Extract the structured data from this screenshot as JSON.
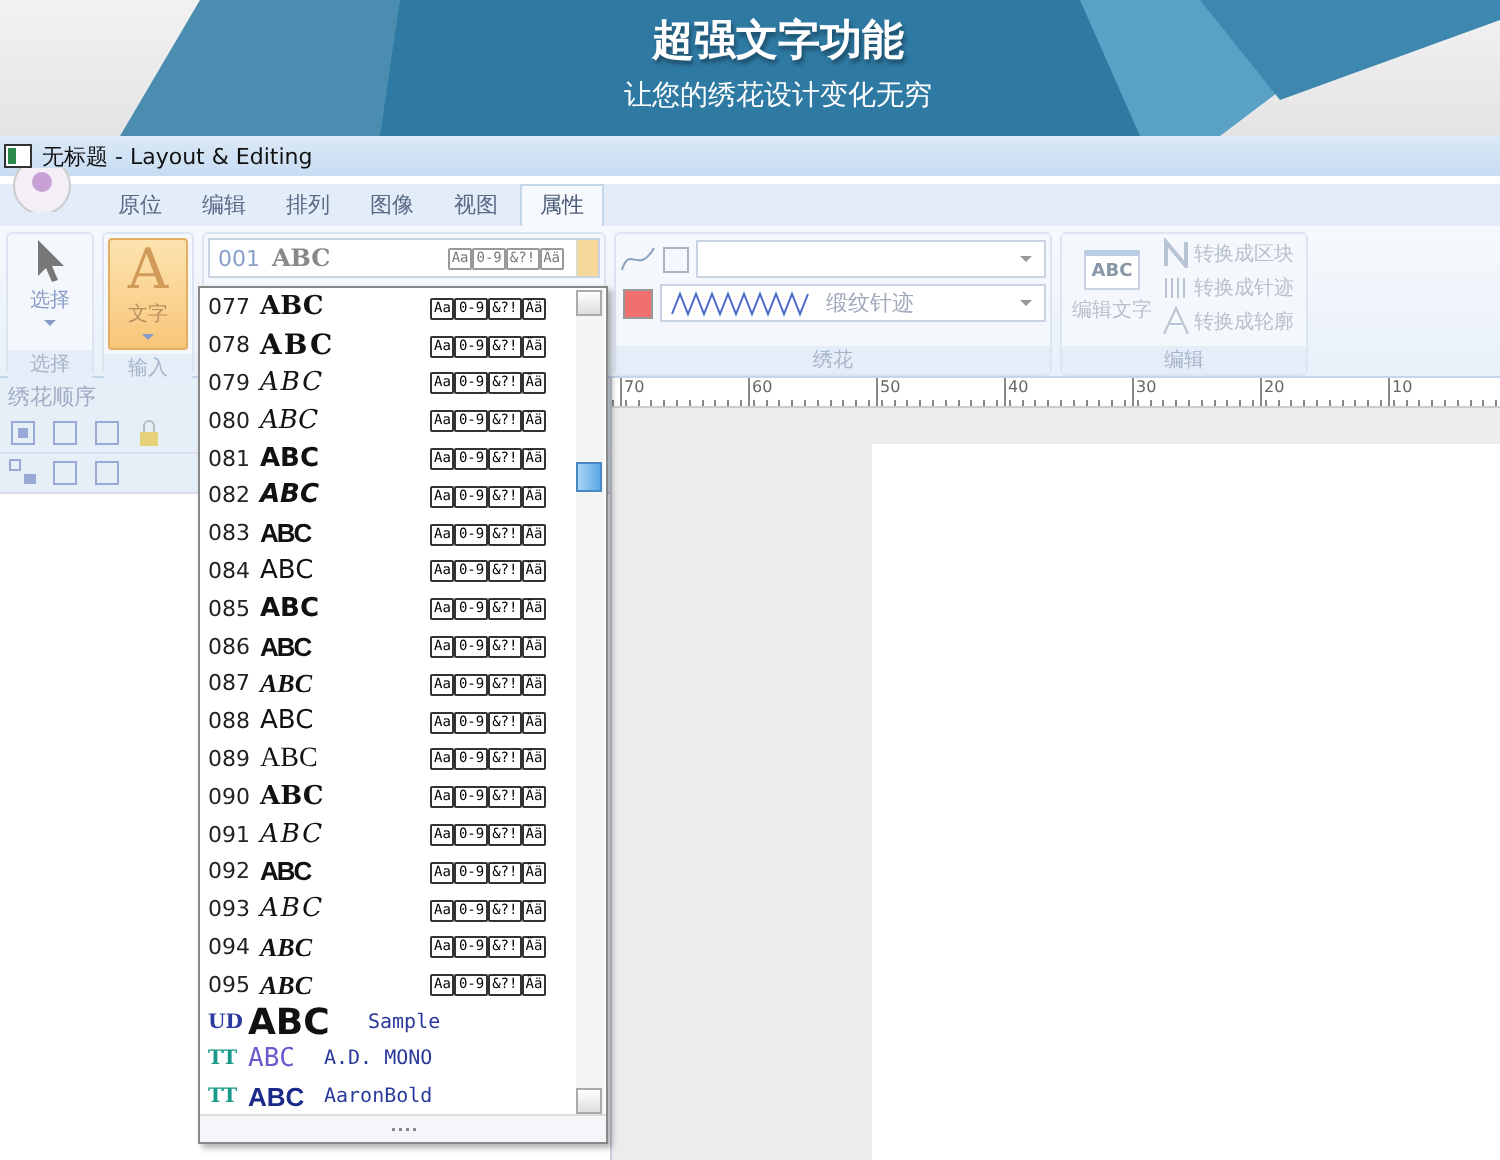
{
  "banner": {
    "headline": "超强文字功能",
    "tagline": "让您的绣花设计变化无穷"
  },
  "window": {
    "title": "无标题 - Layout & Editing"
  },
  "tabs": [
    {
      "label": "原位",
      "selected": false
    },
    {
      "label": "编辑",
      "selected": false
    },
    {
      "label": "排列",
      "selected": false
    },
    {
      "label": "图像",
      "selected": false
    },
    {
      "label": "视图",
      "selected": false
    },
    {
      "label": "属性",
      "selected": true
    }
  ],
  "ribbon": {
    "select_group": {
      "button": "选择",
      "label": "选择",
      "selected": false
    },
    "input_group": {
      "button": "文字",
      "icon_char": "A",
      "label": "输入",
      "selected": true
    },
    "font_combo": {
      "number": "001",
      "sample": "ABC",
      "charsets": [
        "Aa",
        "0-9",
        "&?!",
        "Ää"
      ]
    },
    "embroidery_group": {
      "label": "绣花",
      "stitch": "缎纹针迹"
    },
    "edit_group": {
      "label": "编辑",
      "button": "编辑文字",
      "icon_text": "ABC",
      "disabled": true,
      "actions": [
        {
          "kind": "block",
          "label": "转换成区块"
        },
        {
          "kind": "stitch",
          "label": "转换成针迹"
        },
        {
          "kind": "outline",
          "label": "转换成轮廓"
        }
      ]
    }
  },
  "left_pane": {
    "title": "绣花顺序"
  },
  "ruler": {
    "labels": [
      "70",
      "60",
      "50",
      "40",
      "30",
      "20",
      "10"
    ]
  },
  "font_list": [
    {
      "kind": "embroidery",
      "number": "077",
      "sample": "ABC",
      "charsets": [
        "Aa",
        "0-9",
        "&?!",
        "Ää"
      ]
    },
    {
      "kind": "embroidery",
      "number": "078",
      "sample": "ABC",
      "charsets": [
        "Aa",
        "0-9",
        "&?!",
        "Ää"
      ]
    },
    {
      "kind": "embroidery",
      "number": "079",
      "sample": "ABC",
      "charsets": [
        "Aa",
        "0-9",
        "&?!",
        "Ää"
      ]
    },
    {
      "kind": "embroidery",
      "number": "080",
      "sample": "ABC",
      "charsets": [
        "Aa",
        "0-9",
        "&?!",
        "Ää"
      ]
    },
    {
      "kind": "embroidery",
      "number": "081",
      "sample": "ABC",
      "charsets": [
        "Aa",
        "0-9",
        "&?!",
        "Ää"
      ]
    },
    {
      "kind": "embroidery",
      "number": "082",
      "sample": "ABC",
      "charsets": [
        "Aa",
        "0-9",
        "&?!",
        "Ää"
      ]
    },
    {
      "kind": "embroidery",
      "number": "083",
      "sample": "ABC",
      "charsets": [
        "Aa",
        "0-9",
        "&?!",
        "Ää"
      ]
    },
    {
      "kind": "embroidery",
      "number": "084",
      "sample": "ABC",
      "charsets": [
        "Aa",
        "0-9",
        "&?!",
        "Ää"
      ]
    },
    {
      "kind": "embroidery",
      "number": "085",
      "sample": "ABC",
      "charsets": [
        "Aa",
        "0-9",
        "&?!",
        "Ää"
      ]
    },
    {
      "kind": "embroidery",
      "number": "086",
      "sample": "ABC",
      "charsets": [
        "Aa",
        "0-9",
        "&?!",
        "Ää"
      ]
    },
    {
      "kind": "embroidery",
      "number": "087",
      "sample": "ABC",
      "charsets": [
        "Aa",
        "0-9",
        "&?!",
        "Ää"
      ]
    },
    {
      "kind": "embroidery",
      "number": "088",
      "sample": "ABC",
      "charsets": [
        "Aa",
        "0-9",
        "&?!",
        "Ää"
      ]
    },
    {
      "kind": "embroidery",
      "number": "089",
      "sample": "ABC",
      "charsets": [
        "Aa",
        "0-9",
        "&?!",
        "Ää"
      ]
    },
    {
      "kind": "embroidery",
      "number": "090",
      "sample": "ABC",
      "charsets": [
        "Aa",
        "0-9",
        "&?!",
        "Ää"
      ]
    },
    {
      "kind": "embroidery",
      "number": "091",
      "sample": "ABC",
      "charsets": [
        "Aa",
        "0-9",
        "&?!",
        "Ää"
      ]
    },
    {
      "kind": "embroidery",
      "number": "092",
      "sample": "ABC",
      "charsets": [
        "Aa",
        "0-9",
        "&?!",
        "Ää"
      ]
    },
    {
      "kind": "embroidery",
      "number": "093",
      "sample": "ABC",
      "charsets": [
        "Aa",
        "0-9",
        "&?!",
        "Ää"
      ]
    },
    {
      "kind": "embroidery",
      "number": "094",
      "sample": "ABC",
      "charsets": [
        "Aa",
        "0-9",
        "&?!",
        "Ää"
      ]
    },
    {
      "kind": "embroidery",
      "number": "095",
      "sample": "ABC",
      "charsets": [
        "Aa",
        "0-9",
        "&?!",
        "Ää"
      ]
    },
    {
      "kind": "truetype",
      "mark": "UD",
      "sample": "ABC",
      "name": "Sample"
    },
    {
      "kind": "truetype",
      "mark": "TT",
      "sample": "ABC",
      "name": "A.D. MONO"
    },
    {
      "kind": "truetype",
      "mark": "TT",
      "sample": "ABC",
      "name": "AaronBold"
    }
  ]
}
